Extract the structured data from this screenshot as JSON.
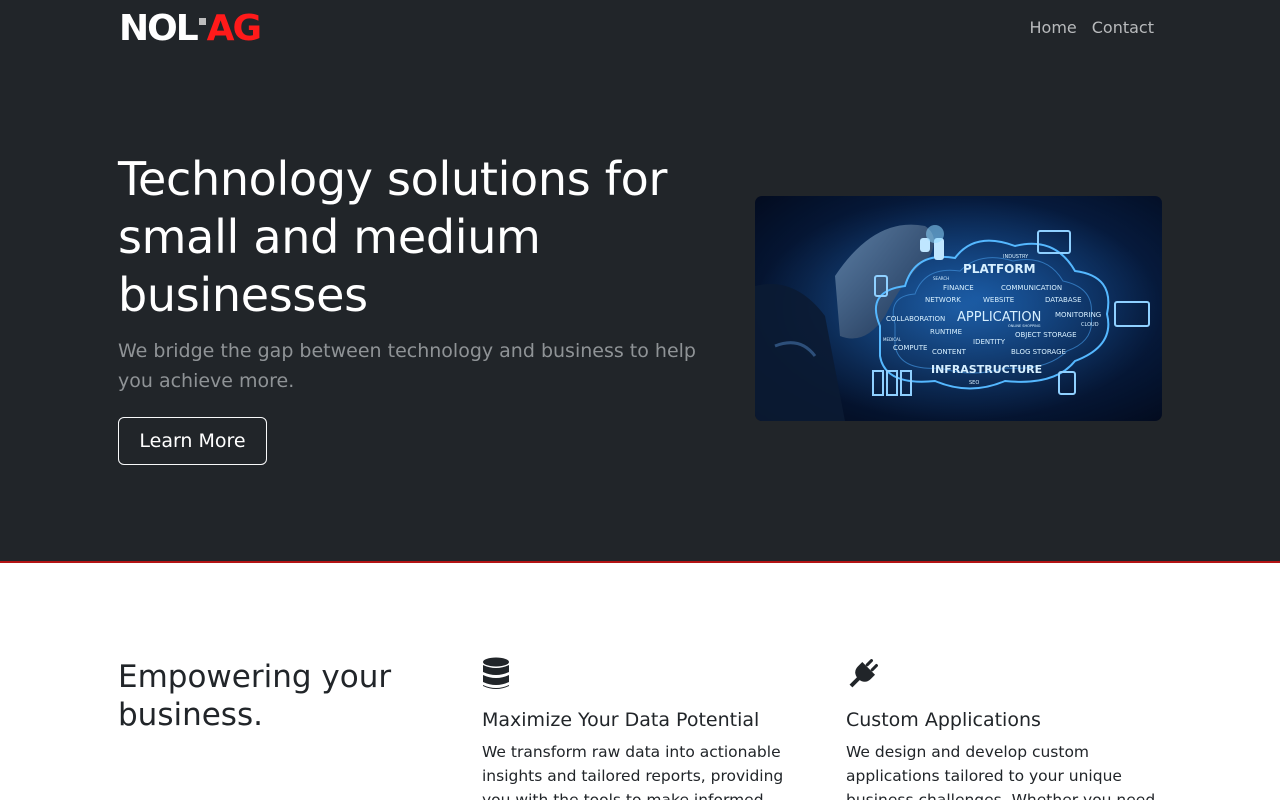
{
  "logo": {
    "part1": "NOL",
    "part2": "AG"
  },
  "nav": {
    "home": "Home",
    "contact": "Contact"
  },
  "hero": {
    "title": "Technology solutions for small and medium businesses",
    "subtitle": "We bridge the gap between technology and business to help you achieve more.",
    "cta": "Learn More",
    "image_words": [
      "INDUSTRY",
      "PLATFORM",
      "SEARCH",
      "FINANCE",
      "COMMUNICATION",
      "NETWORK",
      "WEBSITE",
      "DATABASE",
      "COLLABORATION",
      "APPLICATION",
      "MONITORING",
      "ONLINE SHOPPING",
      "CLOUD",
      "RUNTIME",
      "MEDICAL",
      "IDENTITY",
      "OBJECT STORAGE",
      "COMPUTE",
      "CONTENT",
      "BLOG STORAGE",
      "INFRASTRUCTURE",
      "SEO"
    ]
  },
  "features": {
    "heading": "Empowering your business.",
    "items": [
      {
        "icon": "database-icon",
        "title": "Maximize Your Data Potential",
        "text": "We transform raw data into actionable insights and tailored reports, providing you with the tools to make informed decisions."
      },
      {
        "icon": "plug-icon",
        "title": "Custom Applications",
        "text": "We design and develop custom applications tailored to your unique business challenges. Whether you need a solution to streamline"
      }
    ]
  },
  "colors": {
    "dark": "#212529",
    "brand_red": "#ff1a1a",
    "divider": "#b31414"
  }
}
